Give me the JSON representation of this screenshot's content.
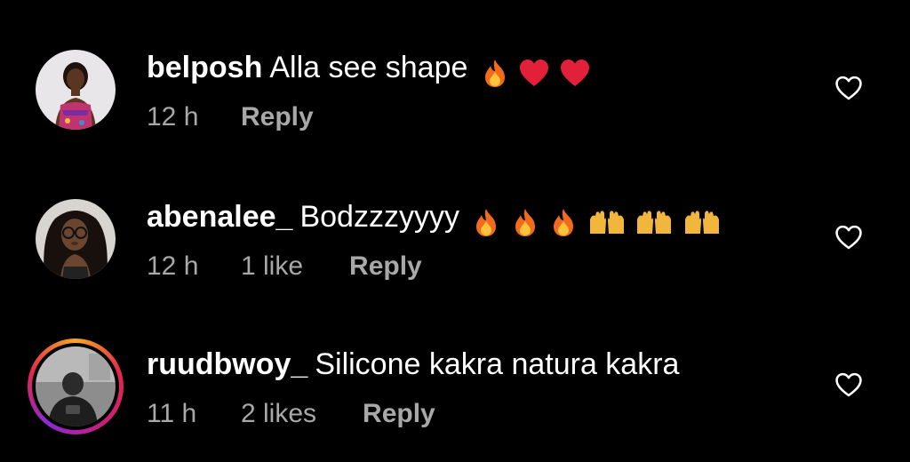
{
  "comments": [
    {
      "username": "belposh",
      "text": "Alla see shape",
      "emojis": [
        "fire-emoji",
        "red-heart-emoji",
        "red-heart-emoji"
      ],
      "time": "12 h",
      "likes": "",
      "reply_label": "Reply",
      "avatar_story_ring": false
    },
    {
      "username": "abenalee_",
      "text": "Bodzzzyyyy",
      "emojis": [
        "fire-emoji",
        "fire-emoji",
        "fire-emoji",
        "raising-hands-emoji",
        "raising-hands-emoji",
        "raising-hands-emoji"
      ],
      "time": "12 h",
      "likes": "1 like",
      "reply_label": "Reply",
      "avatar_story_ring": false
    },
    {
      "username": "ruudbwoy_",
      "text": "Silicone kakra natura kakra",
      "emojis": [],
      "time": "11 h",
      "likes": "2 likes",
      "reply_label": "Reply",
      "avatar_story_ring": true
    }
  ],
  "colors": {
    "background": "#000000",
    "text": "#ffffff",
    "meta": "#a8a8a8",
    "fire": "#f26b1d",
    "heart": "#e3203a",
    "raising_hands": "#f2b63d"
  },
  "icons": {
    "like_button": "heart-outline-icon"
  }
}
